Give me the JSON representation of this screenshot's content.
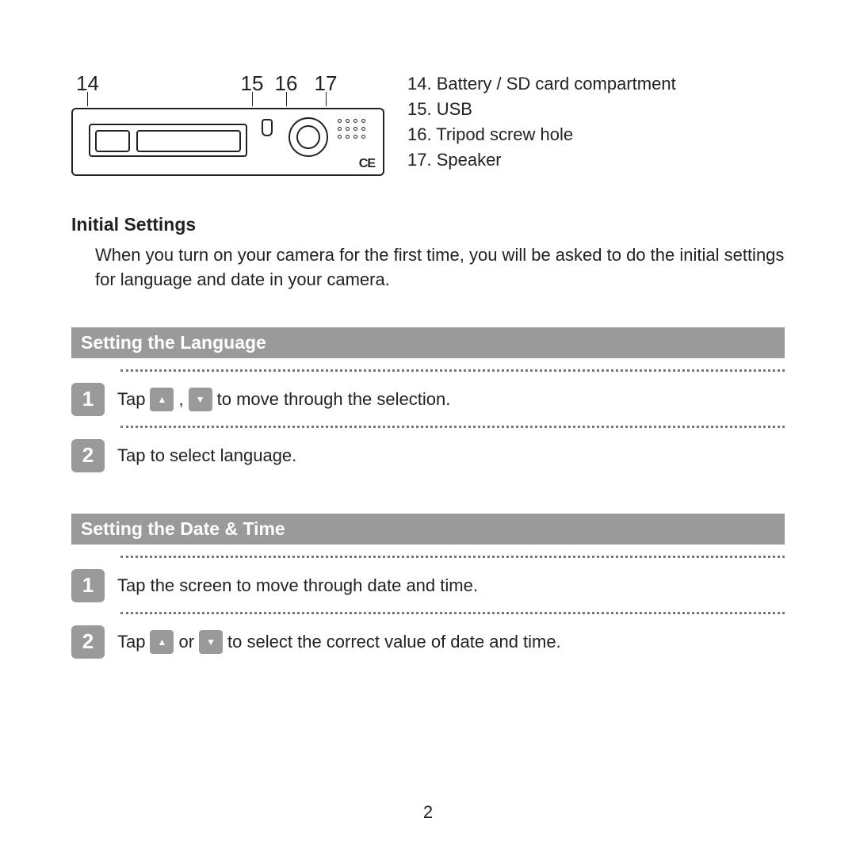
{
  "diagram": {
    "callouts": [
      "14",
      "15",
      "16",
      "17"
    ]
  },
  "legend": {
    "items": [
      "14. Battery / SD card compartment",
      "15. USB",
      "16. Tripod screw hole",
      "17. Speaker"
    ]
  },
  "initial": {
    "heading": "Initial Settings",
    "text": "When you turn on your camera for the first time, you will be asked to do the initial settings for language and date in your camera."
  },
  "lang": {
    "bar": "Setting the Language",
    "step1_a": "Tap",
    "step1_b": ",",
    "step1_c": "to move through the selection.",
    "step2": "Tap to select language."
  },
  "date": {
    "bar": "Setting the Date & Time",
    "step1": "Tap the screen to move through date and time.",
    "step2_a": "Tap",
    "step2_b": "or",
    "step2_c": "to select the correct value of date and time."
  },
  "nums": {
    "one": "1",
    "two": "2"
  },
  "page": "2"
}
